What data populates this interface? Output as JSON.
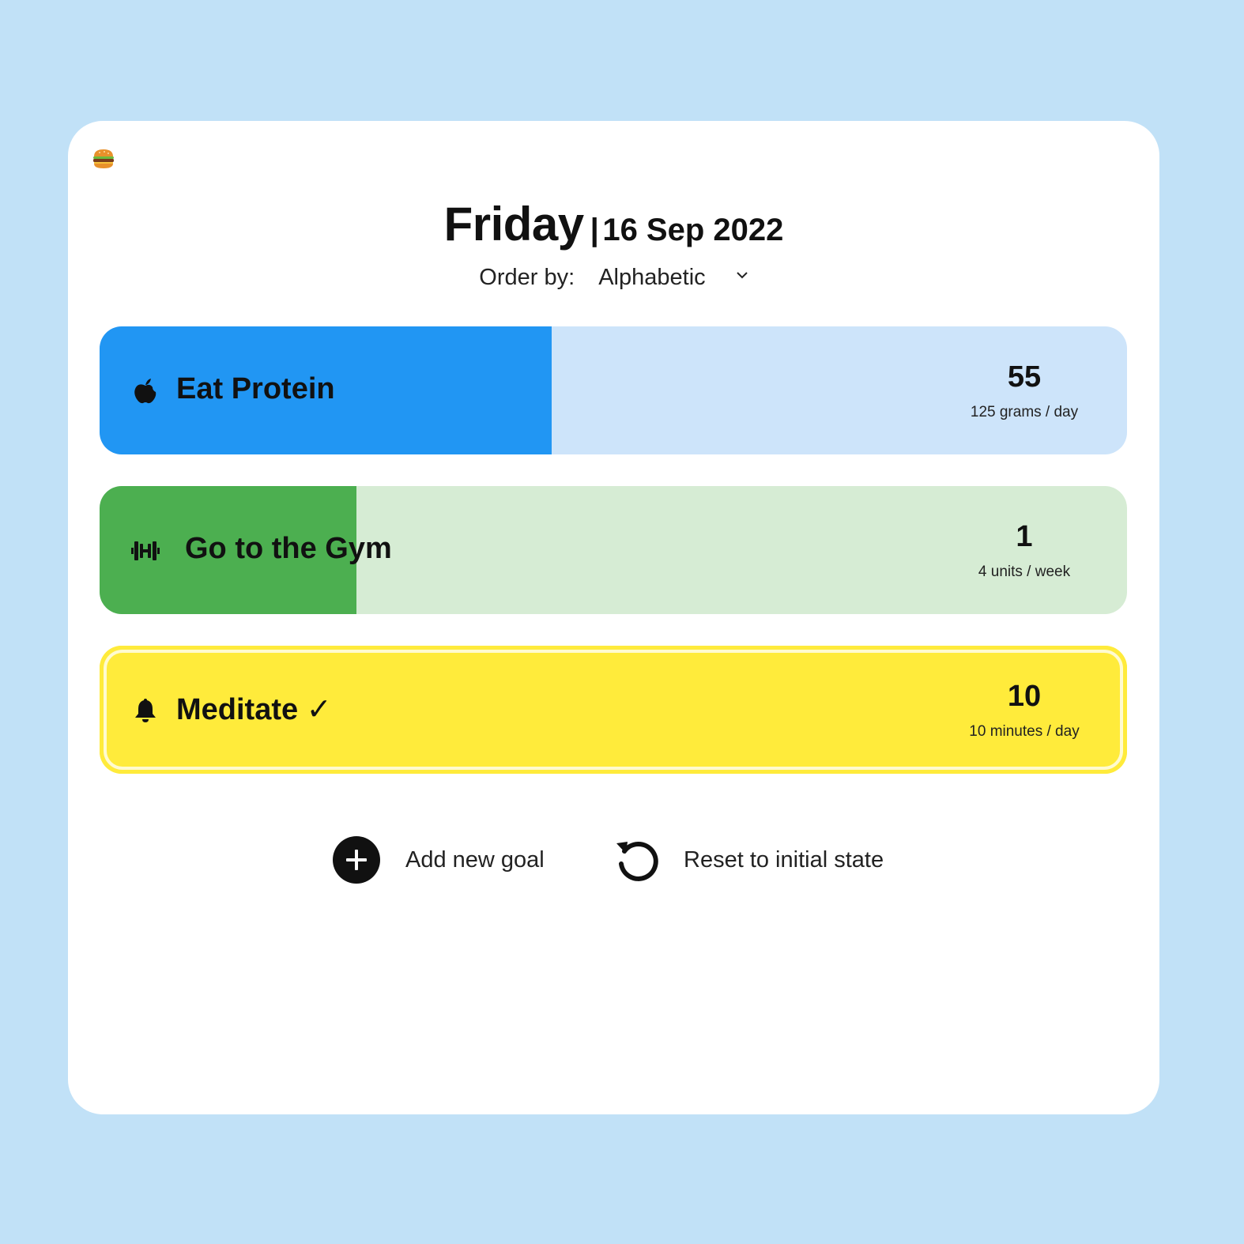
{
  "app": {
    "logo_icon": "hamburger-emoji"
  },
  "header": {
    "day": "Friday",
    "separator": "|",
    "date": "16 Sep 2022"
  },
  "order": {
    "label": "Order by:",
    "selected": "Alphabetic"
  },
  "goals": [
    {
      "name": "Eat Protein",
      "icon": "apple-icon",
      "count": "55",
      "target": "125 grams / day",
      "progress": 0.44,
      "color": "#2196f3",
      "track_color": "#cde4fa"
    },
    {
      "name": "Go to the Gym",
      "icon": "dumbbell-icon",
      "count": "1",
      "target": "4 units / week",
      "progress": 0.25,
      "color": "#4caf50",
      "track_color": "#d6ecd4"
    },
    {
      "name": "Meditate ✓",
      "icon": "bell-icon",
      "count": "10",
      "target": "10 minutes / day",
      "progress": 1.0,
      "color": "#ffeb3b",
      "track_color": "#ffeb3b"
    }
  ],
  "actions": {
    "add_label": "Add new goal",
    "reset_label": "Reset to initial state"
  }
}
